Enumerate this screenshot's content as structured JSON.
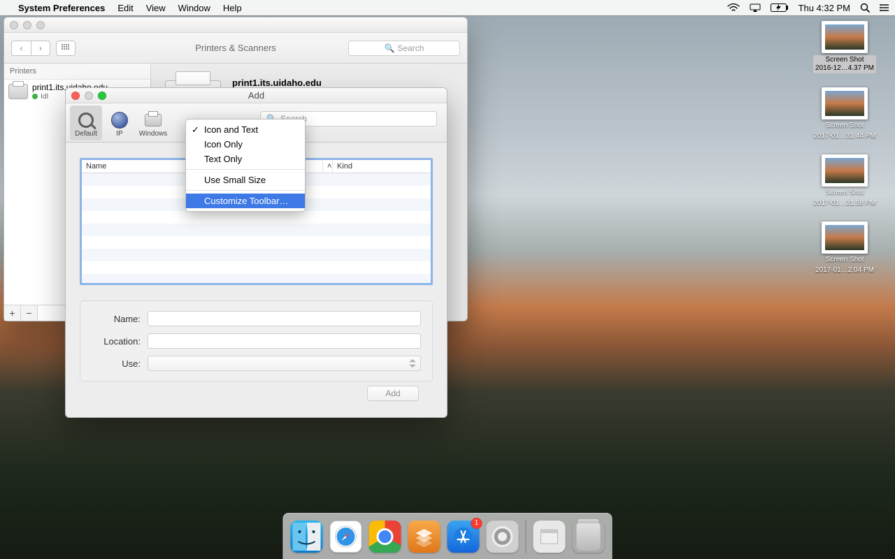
{
  "menubar": {
    "app": "System Preferences",
    "items": [
      "Edit",
      "View",
      "Window",
      "Help"
    ],
    "clock": "Thu 4:32 PM"
  },
  "desktop_icons": [
    {
      "name": "Screen Shot",
      "date": "2016-12…4.37 PM",
      "selected": true
    },
    {
      "name": "Screen Shot",
      "date": "2017-01…31.44 PM",
      "selected": false
    },
    {
      "name": "Screen Shot",
      "date": "2017-01…31.58 PM",
      "selected": false
    },
    {
      "name": "Screen Shot",
      "date": "2017-01…2.04 PM",
      "selected": false
    }
  ],
  "prefs_window": {
    "title": "Printers & Scanners",
    "search_placeholder": "Search",
    "sidebar_header": "Printers",
    "printer": {
      "name": "print1.its.uidaho.edu",
      "status": "Idl"
    },
    "footer": {
      "add": "+",
      "remove": "−"
    },
    "detail_title": "print1.its.uidaho.edu"
  },
  "add_window": {
    "title": "Add",
    "toolbar": {
      "default": "Default",
      "ip": "IP",
      "windows": "Windows",
      "search_label": "Search",
      "search_placeholder": "Search"
    },
    "columns": {
      "name": "Name",
      "kind": "Kind"
    },
    "form": {
      "name_label": "Name:",
      "location_label": "Location:",
      "use_label": "Use:"
    },
    "footer": {
      "add": "Add"
    }
  },
  "context_menu": {
    "items": [
      "Icon and Text",
      "Icon Only",
      "Text Only"
    ],
    "use_small": "Use Small Size",
    "customize": "Customize Toolbar…",
    "checked_index": 0,
    "highlighted": "customize"
  },
  "dock": {
    "appstore_badge": "1"
  }
}
